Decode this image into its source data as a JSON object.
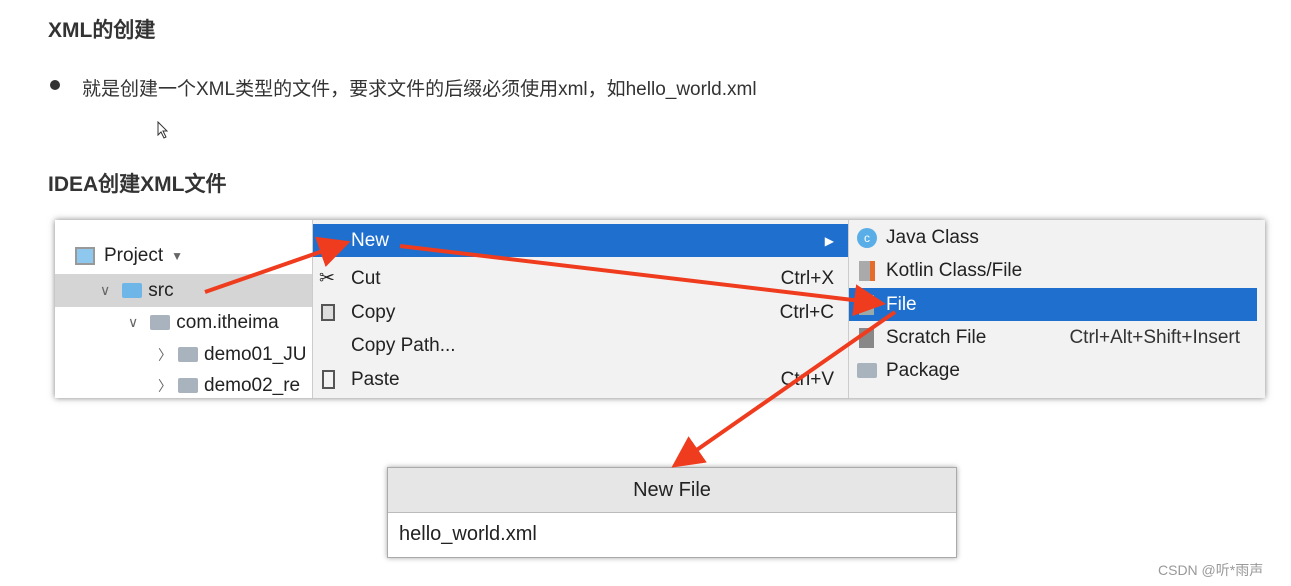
{
  "heading1": "XML的创建",
  "bullet": "就是创建一个XML类型的文件，要求文件的后缀必须使用xml，如hello_world.xml",
  "heading2": "IDEA创建XML文件",
  "project": {
    "title": "Project",
    "tree": [
      "src",
      "com.itheima",
      "demo01_JU",
      "demo02_re"
    ]
  },
  "menu": [
    {
      "label": "New",
      "shortcut": ""
    },
    {
      "label": "Cut",
      "shortcut": "Ctrl+X"
    },
    {
      "label": "Copy",
      "shortcut": "Ctrl+C"
    },
    {
      "label": "Copy Path...",
      "shortcut": ""
    },
    {
      "label": "Paste",
      "shortcut": "Ctrl+V"
    }
  ],
  "submenu": [
    {
      "label": "Java Class",
      "shortcut": ""
    },
    {
      "label": "Kotlin Class/File",
      "shortcut": ""
    },
    {
      "label": "File",
      "shortcut": ""
    },
    {
      "label": "Scratch File",
      "shortcut": "Ctrl+Alt+Shift+Insert"
    },
    {
      "label": "Package",
      "shortcut": ""
    }
  ],
  "dialog": {
    "title": "New File",
    "value": "hello_world.xml"
  },
  "watermark": "CSDN @听*雨声",
  "colors": {
    "selection": "#1f6fce",
    "arrow": "#f03c1e"
  }
}
